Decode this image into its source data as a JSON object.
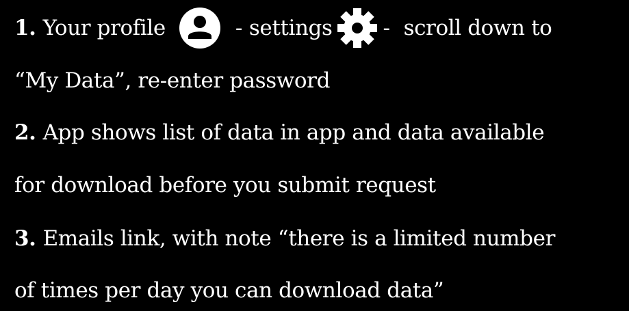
{
  "steps": [
    {
      "number": "1.",
      "text_a": "Your profile",
      "separator_a": "-",
      "text_b": "settings",
      "separator_b": "-",
      "text_c": "scroll down to",
      "continuation": "“My Data”, re-enter password",
      "icons": [
        "profile-icon",
        "gear-icon"
      ]
    },
    {
      "number": "2.",
      "text": "App shows list of data in app and data available",
      "continuation": "for download before you submit request"
    },
    {
      "number": "3.",
      "text": "Emails link, with note “there is a limited number",
      "continuation": "of times per day you can download data”"
    }
  ],
  "colors": {
    "background": "#000000",
    "text": "#ffffff"
  }
}
